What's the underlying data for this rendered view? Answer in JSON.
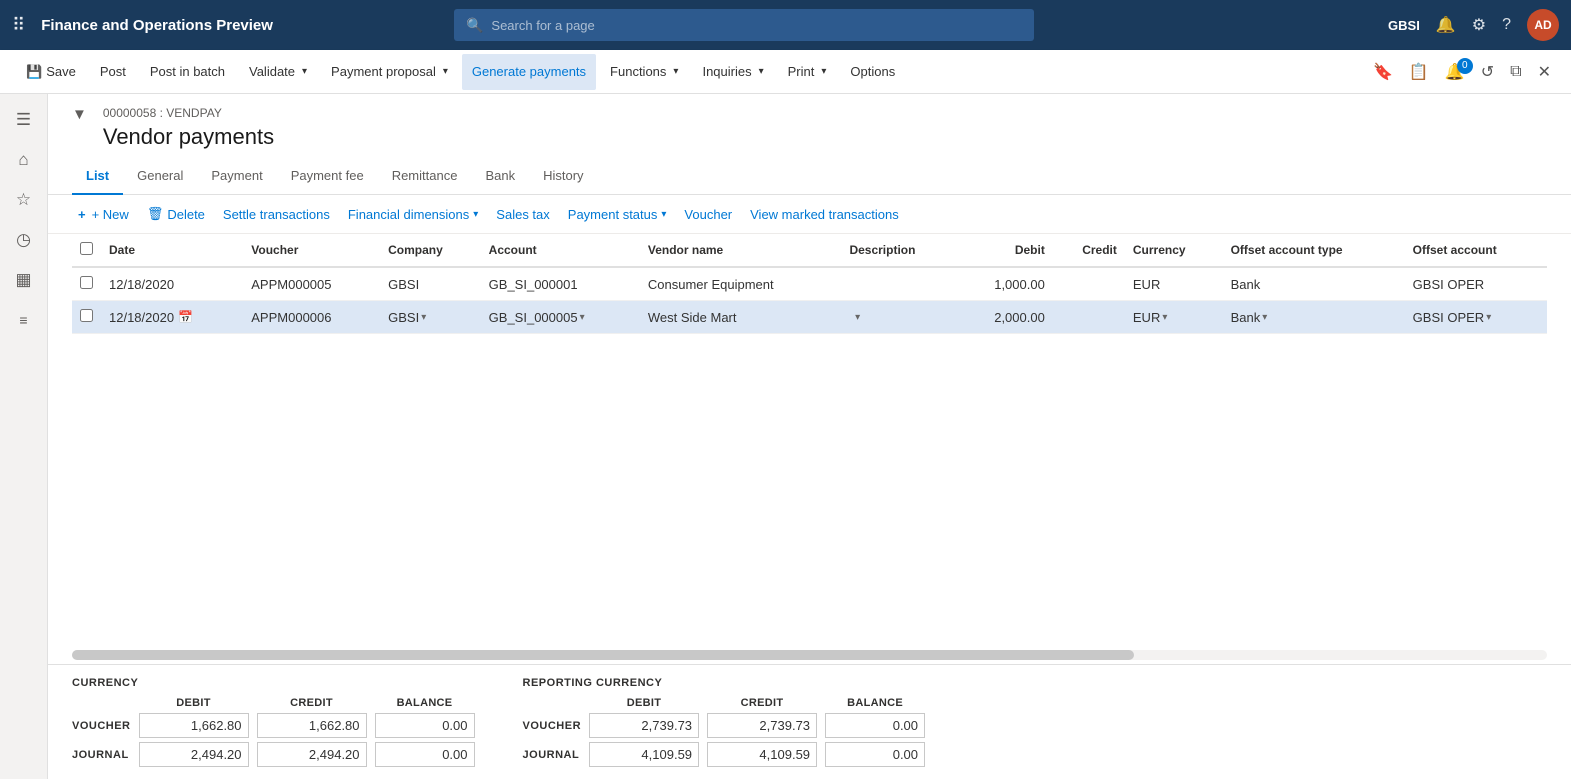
{
  "app": {
    "title": "Finance and Operations Preview",
    "search_placeholder": "Search for a page"
  },
  "topnav": {
    "user": "GBSI",
    "avatar": "AD"
  },
  "toolbar": {
    "save": "Save",
    "post": "Post",
    "post_in_batch": "Post in batch",
    "validate": "Validate",
    "payment_proposal": "Payment proposal",
    "generate_payments": "Generate payments",
    "functions": "Functions",
    "inquiries": "Inquiries",
    "print": "Print",
    "options": "Options"
  },
  "page": {
    "breadcrumb": "00000058 : VENDPAY",
    "title": "Vendor payments"
  },
  "tabs": [
    {
      "id": "list",
      "label": "List",
      "active": true
    },
    {
      "id": "general",
      "label": "General",
      "active": false
    },
    {
      "id": "payment",
      "label": "Payment",
      "active": false
    },
    {
      "id": "payment_fee",
      "label": "Payment fee",
      "active": false
    },
    {
      "id": "remittance",
      "label": "Remittance",
      "active": false
    },
    {
      "id": "bank",
      "label": "Bank",
      "active": false
    },
    {
      "id": "history",
      "label": "History",
      "active": false
    }
  ],
  "table_toolbar": {
    "new": "+ New",
    "delete": "🗑 Delete",
    "settle_transactions": "Settle transactions",
    "financial_dimensions": "Financial dimensions",
    "sales_tax": "Sales tax",
    "payment_status": "Payment status",
    "voucher": "Voucher",
    "view_marked": "View marked transactions"
  },
  "table": {
    "columns": [
      {
        "id": "check",
        "label": ""
      },
      {
        "id": "date",
        "label": "Date"
      },
      {
        "id": "voucher",
        "label": "Voucher"
      },
      {
        "id": "company",
        "label": "Company"
      },
      {
        "id": "account",
        "label": "Account"
      },
      {
        "id": "vendor_name",
        "label": "Vendor name"
      },
      {
        "id": "description",
        "label": "Description"
      },
      {
        "id": "debit",
        "label": "Debit",
        "align": "right"
      },
      {
        "id": "credit",
        "label": "Credit",
        "align": "right"
      },
      {
        "id": "currency",
        "label": "Currency"
      },
      {
        "id": "offset_account_type",
        "label": "Offset account type"
      },
      {
        "id": "offset_account",
        "label": "Offset account"
      }
    ],
    "rows": [
      {
        "selected": false,
        "date": "12/18/2020",
        "voucher": "APPM000005",
        "company": "GBSI",
        "account": "GB_SI_000001",
        "vendor_name": "Consumer Equipment",
        "description": "",
        "debit": "1,000.00",
        "credit": "",
        "currency": "EUR",
        "offset_account_type": "Bank",
        "offset_account": "GBSI OPER",
        "has_dropdown": false
      },
      {
        "selected": true,
        "date": "12/18/2020",
        "voucher": "APPM000006",
        "company": "GBSI",
        "account": "GB_SI_000005",
        "vendor_name": "West Side Mart",
        "description": "",
        "debit": "2,000.00",
        "credit": "",
        "currency": "EUR",
        "offset_account_type": "Bank",
        "offset_account": "GBSI OPER",
        "has_dropdown": true
      }
    ]
  },
  "footer": {
    "currency_section": {
      "title": "CURRENCY",
      "col_debit": "DEBIT",
      "col_credit": "CREDIT",
      "col_balance": "BALANCE",
      "rows": [
        {
          "label": "VOUCHER",
          "debit": "1,662.80",
          "credit": "1,662.80",
          "balance": "0.00"
        },
        {
          "label": "JOURNAL",
          "debit": "2,494.20",
          "credit": "2,494.20",
          "balance": "0.00"
        }
      ]
    },
    "reporting_section": {
      "title": "REPORTING CURRENCY",
      "col_debit": "DEBIT",
      "col_credit": "CREDIT",
      "col_balance": "BALANCE",
      "rows": [
        {
          "label": "VOUCHER",
          "debit": "2,739.73",
          "credit": "2,739.73",
          "balance": "0.00"
        },
        {
          "label": "JOURNAL",
          "debit": "4,109.59",
          "credit": "4,109.59",
          "balance": "0.00"
        }
      ]
    }
  },
  "sidebar": {
    "items": [
      {
        "id": "hamburger",
        "icon": "☰"
      },
      {
        "id": "home",
        "icon": "⌂"
      },
      {
        "id": "star",
        "icon": "☆"
      },
      {
        "id": "clock",
        "icon": "◷"
      },
      {
        "id": "grid",
        "icon": "▦"
      },
      {
        "id": "list",
        "icon": "☰"
      }
    ]
  }
}
